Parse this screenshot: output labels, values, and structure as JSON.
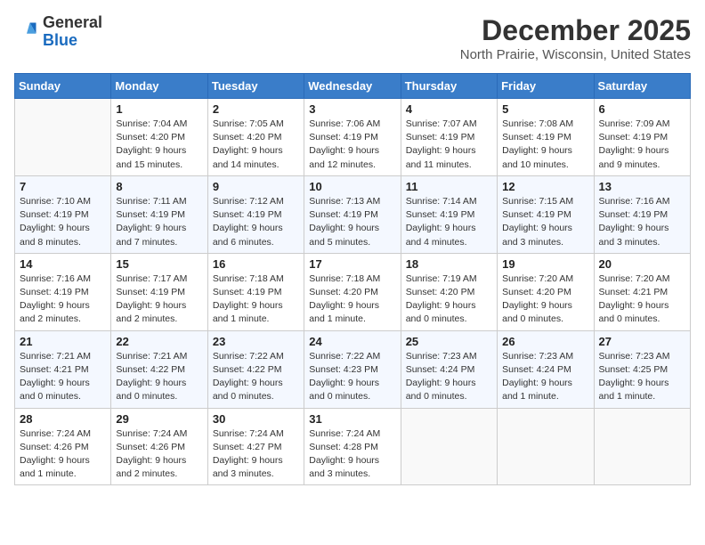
{
  "header": {
    "logo_general": "General",
    "logo_blue": "Blue",
    "month_title": "December 2025",
    "location": "North Prairie, Wisconsin, United States"
  },
  "days_of_week": [
    "Sunday",
    "Monday",
    "Tuesday",
    "Wednesday",
    "Thursday",
    "Friday",
    "Saturday"
  ],
  "weeks": [
    [
      {
        "num": "",
        "info": ""
      },
      {
        "num": "1",
        "info": "Sunrise: 7:04 AM\nSunset: 4:20 PM\nDaylight: 9 hours\nand 15 minutes."
      },
      {
        "num": "2",
        "info": "Sunrise: 7:05 AM\nSunset: 4:20 PM\nDaylight: 9 hours\nand 14 minutes."
      },
      {
        "num": "3",
        "info": "Sunrise: 7:06 AM\nSunset: 4:19 PM\nDaylight: 9 hours\nand 12 minutes."
      },
      {
        "num": "4",
        "info": "Sunrise: 7:07 AM\nSunset: 4:19 PM\nDaylight: 9 hours\nand 11 minutes."
      },
      {
        "num": "5",
        "info": "Sunrise: 7:08 AM\nSunset: 4:19 PM\nDaylight: 9 hours\nand 10 minutes."
      },
      {
        "num": "6",
        "info": "Sunrise: 7:09 AM\nSunset: 4:19 PM\nDaylight: 9 hours\nand 9 minutes."
      }
    ],
    [
      {
        "num": "7",
        "info": "Sunrise: 7:10 AM\nSunset: 4:19 PM\nDaylight: 9 hours\nand 8 minutes."
      },
      {
        "num": "8",
        "info": "Sunrise: 7:11 AM\nSunset: 4:19 PM\nDaylight: 9 hours\nand 7 minutes."
      },
      {
        "num": "9",
        "info": "Sunrise: 7:12 AM\nSunset: 4:19 PM\nDaylight: 9 hours\nand 6 minutes."
      },
      {
        "num": "10",
        "info": "Sunrise: 7:13 AM\nSunset: 4:19 PM\nDaylight: 9 hours\nand 5 minutes."
      },
      {
        "num": "11",
        "info": "Sunrise: 7:14 AM\nSunset: 4:19 PM\nDaylight: 9 hours\nand 4 minutes."
      },
      {
        "num": "12",
        "info": "Sunrise: 7:15 AM\nSunset: 4:19 PM\nDaylight: 9 hours\nand 3 minutes."
      },
      {
        "num": "13",
        "info": "Sunrise: 7:16 AM\nSunset: 4:19 PM\nDaylight: 9 hours\nand 3 minutes."
      }
    ],
    [
      {
        "num": "14",
        "info": "Sunrise: 7:16 AM\nSunset: 4:19 PM\nDaylight: 9 hours\nand 2 minutes."
      },
      {
        "num": "15",
        "info": "Sunrise: 7:17 AM\nSunset: 4:19 PM\nDaylight: 9 hours\nand 2 minutes."
      },
      {
        "num": "16",
        "info": "Sunrise: 7:18 AM\nSunset: 4:19 PM\nDaylight: 9 hours\nand 1 minute."
      },
      {
        "num": "17",
        "info": "Sunrise: 7:18 AM\nSunset: 4:20 PM\nDaylight: 9 hours\nand 1 minute."
      },
      {
        "num": "18",
        "info": "Sunrise: 7:19 AM\nSunset: 4:20 PM\nDaylight: 9 hours\nand 0 minutes."
      },
      {
        "num": "19",
        "info": "Sunrise: 7:20 AM\nSunset: 4:20 PM\nDaylight: 9 hours\nand 0 minutes."
      },
      {
        "num": "20",
        "info": "Sunrise: 7:20 AM\nSunset: 4:21 PM\nDaylight: 9 hours\nand 0 minutes."
      }
    ],
    [
      {
        "num": "21",
        "info": "Sunrise: 7:21 AM\nSunset: 4:21 PM\nDaylight: 9 hours\nand 0 minutes."
      },
      {
        "num": "22",
        "info": "Sunrise: 7:21 AM\nSunset: 4:22 PM\nDaylight: 9 hours\nand 0 minutes."
      },
      {
        "num": "23",
        "info": "Sunrise: 7:22 AM\nSunset: 4:22 PM\nDaylight: 9 hours\nand 0 minutes."
      },
      {
        "num": "24",
        "info": "Sunrise: 7:22 AM\nSunset: 4:23 PM\nDaylight: 9 hours\nand 0 minutes."
      },
      {
        "num": "25",
        "info": "Sunrise: 7:23 AM\nSunset: 4:24 PM\nDaylight: 9 hours\nand 0 minutes."
      },
      {
        "num": "26",
        "info": "Sunrise: 7:23 AM\nSunset: 4:24 PM\nDaylight: 9 hours\nand 1 minute."
      },
      {
        "num": "27",
        "info": "Sunrise: 7:23 AM\nSunset: 4:25 PM\nDaylight: 9 hours\nand 1 minute."
      }
    ],
    [
      {
        "num": "28",
        "info": "Sunrise: 7:24 AM\nSunset: 4:26 PM\nDaylight: 9 hours\nand 1 minute."
      },
      {
        "num": "29",
        "info": "Sunrise: 7:24 AM\nSunset: 4:26 PM\nDaylight: 9 hours\nand 2 minutes."
      },
      {
        "num": "30",
        "info": "Sunrise: 7:24 AM\nSunset: 4:27 PM\nDaylight: 9 hours\nand 3 minutes."
      },
      {
        "num": "31",
        "info": "Sunrise: 7:24 AM\nSunset: 4:28 PM\nDaylight: 9 hours\nand 3 minutes."
      },
      {
        "num": "",
        "info": ""
      },
      {
        "num": "",
        "info": ""
      },
      {
        "num": "",
        "info": ""
      }
    ]
  ]
}
